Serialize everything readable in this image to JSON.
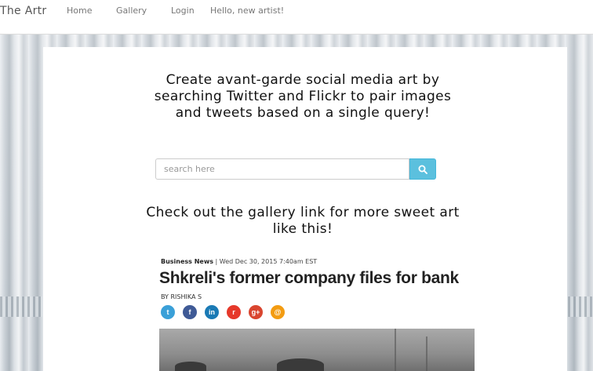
{
  "navbar": {
    "brand": "The Artr",
    "links": [
      {
        "label": "Home"
      },
      {
        "label": "Gallery"
      },
      {
        "label": "Login"
      }
    ],
    "greeting": "Hello, new artist!"
  },
  "hero": {
    "tagline": "Create avant-garde social media art by searching Twitter and Flickr to pair images and tweets based on a single query!",
    "search_placeholder": "search here",
    "search_icon": "search-icon",
    "gallery_note": "Check out the gallery link for more sweet art like this!"
  },
  "article": {
    "section": "Business News",
    "timestamp": "| Wed Dec 30, 2015 7:40am EST",
    "headline": "Shkreli's former company files for bank",
    "byline": "BY RISHIKA S",
    "share_buttons": [
      {
        "icon": "twitter-icon",
        "glyph": "t",
        "color": "#3aa0d8"
      },
      {
        "icon": "facebook-icon",
        "glyph": "f",
        "color": "#3f5a96"
      },
      {
        "icon": "linkedin-icon",
        "glyph": "in",
        "color": "#1a7ab5"
      },
      {
        "icon": "reddit-icon",
        "glyph": "r",
        "color": "#e6382a"
      },
      {
        "icon": "google-plus-icon",
        "glyph": "g+",
        "color": "#d9452f"
      },
      {
        "icon": "email-icon",
        "glyph": "@",
        "color": "#f39c12"
      }
    ]
  }
}
